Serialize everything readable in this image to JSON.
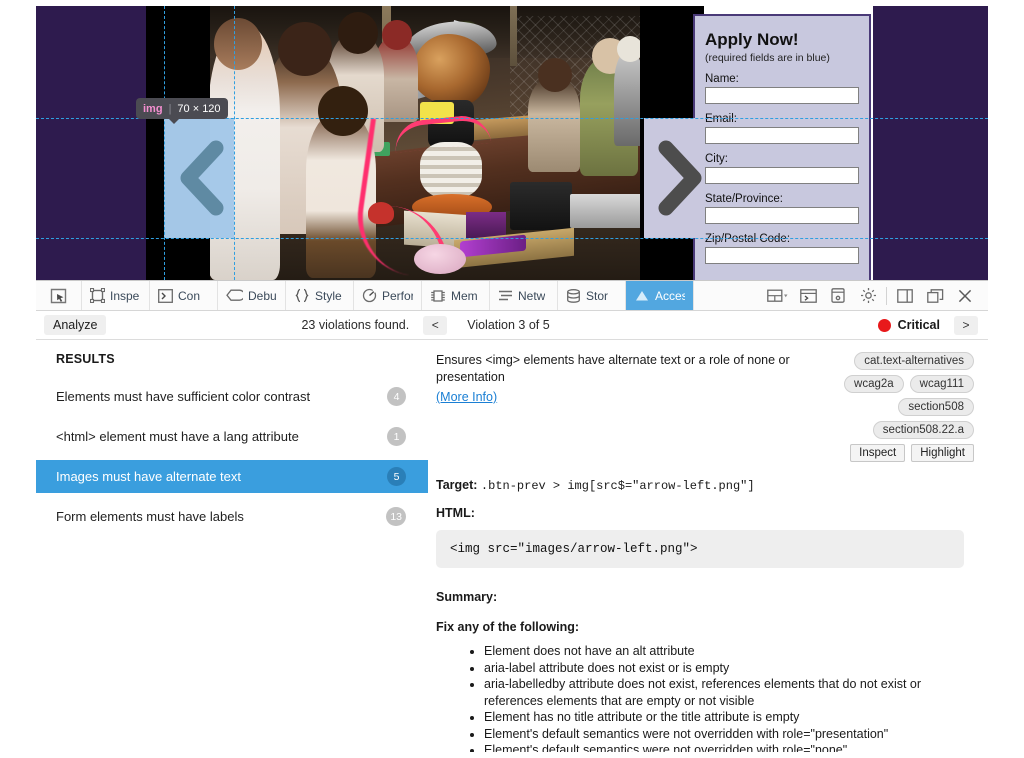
{
  "viewport": {
    "element_badge": {
      "tag": "img",
      "separator": "|",
      "dimensions": "70 × 120"
    },
    "carousel": {
      "prev_icon": "chevron-left-icon",
      "next_icon": "chevron-right-icon"
    },
    "form": {
      "title": "Apply Now!",
      "required_note": "(required fields are in blue)",
      "fields": [
        {
          "label": "Name:",
          "value": "",
          "placeholder": ""
        },
        {
          "label": "Email:",
          "value": "",
          "placeholder": ""
        },
        {
          "label": "City:",
          "value": "",
          "placeholder": ""
        },
        {
          "label": "State/Province:",
          "value": "",
          "placeholder": ""
        },
        {
          "label": "Zip/Postal Code:",
          "value": "",
          "placeholder": ""
        }
      ]
    }
  },
  "devtools": {
    "tabs": [
      {
        "label": "",
        "icon": "inspect-cursor-icon",
        "active": false,
        "width": "first"
      },
      {
        "label": "Inspe",
        "icon": "elements-icon",
        "active": false,
        "width": "std"
      },
      {
        "label": "Con",
        "icon": "console-icon",
        "active": false,
        "width": "std"
      },
      {
        "label": "Debu",
        "icon": "debugger-icon",
        "active": false,
        "width": "std"
      },
      {
        "label": "Style E",
        "icon": "style-editor-icon",
        "active": false,
        "width": "std"
      },
      {
        "label": "Perform",
        "icon": "performance-icon",
        "active": false,
        "width": "std"
      },
      {
        "label": "Mem",
        "icon": "memory-icon",
        "active": false,
        "width": "std"
      },
      {
        "label": "Netw",
        "icon": "network-icon",
        "active": false,
        "width": "std"
      },
      {
        "label": "Stor",
        "icon": "storage-icon",
        "active": false,
        "width": "std"
      },
      {
        "label": "Access",
        "icon": "accessibility-icon",
        "active": true,
        "width": "std"
      }
    ],
    "tool_icons": [
      {
        "name": "layout-split-dropdown-icon"
      },
      {
        "name": "split-console-icon"
      },
      {
        "name": "responsive-device-icon"
      },
      {
        "name": "settings-gear-icon"
      },
      {
        "name": "dock-side-icon"
      },
      {
        "name": "separate-window-icon"
      },
      {
        "name": "close-icon"
      }
    ],
    "analyzebar": {
      "analyze_label": "Analyze",
      "violations_found": "23 violations found.",
      "prev_label": "<",
      "next_label": ">",
      "violation_counter": "Violation 3 of 5",
      "severity_label": "Critical",
      "severity_color": "#e8191b"
    },
    "results": {
      "heading": "RESULTS",
      "items": [
        {
          "label": "Elements must have sufficient color contrast",
          "count": "4",
          "selected": false
        },
        {
          "label": "<html> element must have a lang attribute",
          "count": "1",
          "selected": false
        },
        {
          "label": "Images must have alternate text",
          "count": "5",
          "selected": true
        },
        {
          "label": "Form elements must have labels",
          "count": "13",
          "selected": false
        }
      ]
    },
    "detail": {
      "description": "Ensures <img> elements have alternate text or a role of none or presentation",
      "more_info_label": "(More Info)",
      "tags_row1": [
        "cat.text-alternatives"
      ],
      "tags_row2": [
        "wcag2a",
        "wcag111"
      ],
      "tags_row3": [
        "section508"
      ],
      "tags_row4": [
        "section508.22.a"
      ],
      "inspect_label": "Inspect",
      "highlight_label": "Highlight",
      "target_label": "Target:",
      "target_selector": ".btn-prev > img[src$=\"arrow-left.png\"]",
      "html_label": "HTML:",
      "html_snippet": "<img src=\"images/arrow-left.png\">",
      "summary_label": "Summary:",
      "fix_label": "Fix any of the following:",
      "fix_items": [
        "Element does not have an alt attribute",
        "aria-label attribute does not exist or is empty",
        "aria-labelledby attribute does not exist, references elements that do not exist or references elements that are empty or not visible",
        "Element has no title attribute or the title attribute is empty",
        "Element's default semantics were not overridden with role=\"presentation\"",
        "Element's default semantics were not overridden with role=\"none\""
      ]
    }
  },
  "colors": {
    "accent_blue": "#3a9ede",
    "tab_active_blue": "#52a7e0",
    "critical_red": "#e8191b",
    "page_purple": "#2e1b4e",
    "form_bg": "#c8c8de",
    "highlight_overlay": "#6fa8dc",
    "guide_dashed": "#2f9fe0"
  }
}
